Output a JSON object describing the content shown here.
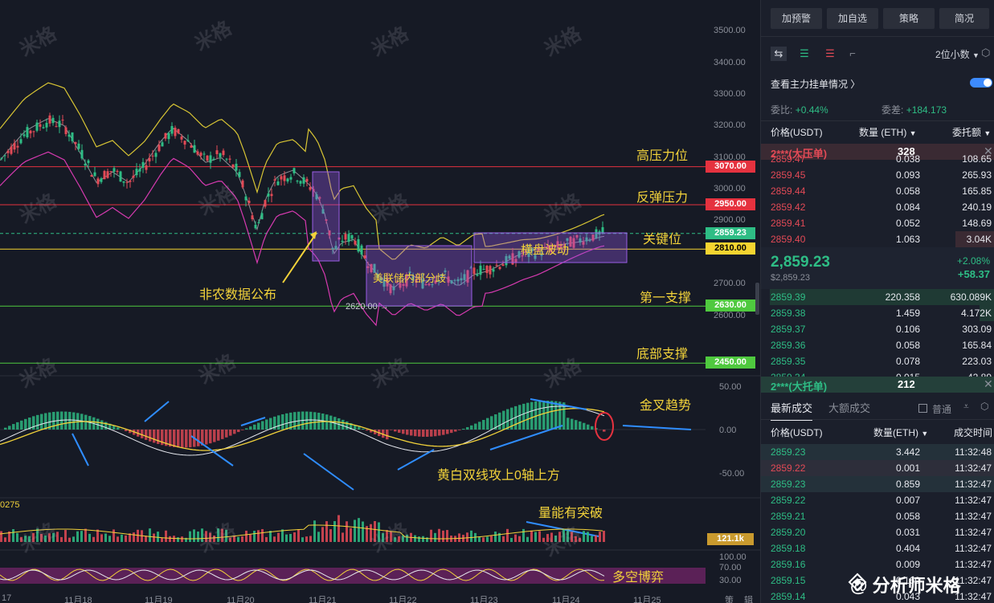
{
  "chart": {
    "y_axis_labels": [
      "3500.00",
      "3400.00",
      "3300.00",
      "3200.00",
      "3100.00",
      "3000.00",
      "2900.00",
      "2800.00",
      "2700.00",
      "2600.00"
    ],
    "x_axis_labels": [
      "17",
      "11月18",
      "11月19",
      "11月20",
      "11月21",
      "11月22",
      "11月23",
      "11月24",
      "11月25",
      "策",
      "辑"
    ],
    "levels": [
      {
        "price": "3070.00",
        "label": "高压力位",
        "color": "#e5323f",
        "tag_text_color": "#ffffff"
      },
      {
        "price": "2950.00",
        "label": "反弹压力",
        "color": "#e5323f",
        "tag_text_color": "#ffffff"
      },
      {
        "price": "2859.23",
        "label": "关键位",
        "color": "#2ebd85",
        "tag_text_color": "#ffffff"
      },
      {
        "price": "2810.00",
        "label": "",
        "color": "#f5d430",
        "tag_text_color": "#000000"
      },
      {
        "price": "2630.00",
        "label": "第一支撑",
        "color": "#4fc93f",
        "tag_text_color": "#ffffff"
      },
      {
        "price": "2450.00",
        "label": "底部支撑",
        "color": "#4fc93f",
        "tag_text_color": "#ffffff"
      }
    ],
    "low_marker": "2620.00 →",
    "annotations": {
      "nfp": "非农数据公布",
      "fed": "美联储内部分歧",
      "sideways": "横盘波动",
      "golden_cross": "金叉趋势",
      "macd_above_zero": "黄白双线攻上0轴上方",
      "volume_break": "量能有突破",
      "bull_bear": "多空博弈"
    },
    "macd_labels": [
      "50.00",
      "0.00",
      "-50.00"
    ],
    "volume_label": "121.1k",
    "volume_left_label": "0275",
    "osc_labels": [
      "100.00",
      "70.00",
      "30.00"
    ],
    "watermark": "米格",
    "brand": "分析师米格"
  },
  "panel": {
    "buttons": [
      "加预警",
      "加自选",
      "策略",
      "简况"
    ],
    "precision": "2位小数",
    "main_orders_label": "查看主力挂单情况",
    "ratio_label": "委比:",
    "ratio_value": "+0.44%",
    "diff_label": "委差:",
    "diff_value": "+184.173",
    "book_headers": [
      "价格(USDT)",
      "数量 (ETH)",
      "委托额"
    ],
    "big_ask": {
      "label": "2***(大压单)",
      "value": "328"
    },
    "asks": [
      {
        "price": "2859.47",
        "qty": "0.038",
        "amt": "108.65"
      },
      {
        "price": "2859.45",
        "qty": "0.093",
        "amt": "265.93"
      },
      {
        "price": "2859.44",
        "qty": "0.058",
        "amt": "165.85"
      },
      {
        "price": "2859.42",
        "qty": "0.084",
        "amt": "240.19"
      },
      {
        "price": "2859.41",
        "qty": "0.052",
        "amt": "148.69"
      },
      {
        "price": "2859.40",
        "qty": "1.063",
        "amt": "3.04K"
      }
    ],
    "last_price": "2,859.23",
    "last_price_sub": "$2,859.23",
    "change_pct": "+2.08%",
    "change_abs": "+58.37",
    "bids": [
      {
        "price": "2859.39",
        "qty": "220.358",
        "amt": "630.089K"
      },
      {
        "price": "2859.38",
        "qty": "1.459",
        "amt": "4.172K"
      },
      {
        "price": "2859.37",
        "qty": "0.106",
        "amt": "303.09"
      },
      {
        "price": "2859.36",
        "qty": "0.058",
        "amt": "165.84"
      },
      {
        "price": "2859.35",
        "qty": "0.078",
        "amt": "223.03"
      },
      {
        "price": "2859.34",
        "qty": "0.015",
        "amt": "42.89"
      }
    ],
    "big_bid": {
      "label": "2***(大托单)",
      "value": "212"
    },
    "trades_tabs": [
      "最新成交",
      "大额成交"
    ],
    "normal_label": "普通",
    "trade_headers": [
      "价格(USDT)",
      "数量(ETH)",
      "成交时间"
    ],
    "trades": [
      {
        "price": "2859.23",
        "qty": "3.442",
        "time": "11:32:48",
        "side": "buy"
      },
      {
        "price": "2859.22",
        "qty": "0.001",
        "time": "11:32:47",
        "side": "sell"
      },
      {
        "price": "2859.23",
        "qty": "0.859",
        "time": "11:32:47",
        "side": "buy"
      },
      {
        "price": "2859.22",
        "qty": "0.007",
        "time": "11:32:47",
        "side": "buy"
      },
      {
        "price": "2859.21",
        "qty": "0.058",
        "time": "11:32:47",
        "side": "buy"
      },
      {
        "price": "2859.20",
        "qty": "0.031",
        "time": "11:32:47",
        "side": "buy"
      },
      {
        "price": "2859.18",
        "qty": "0.404",
        "time": "11:32:47",
        "side": "buy"
      },
      {
        "price": "2859.16",
        "qty": "0.009",
        "time": "11:32:47",
        "side": "buy"
      },
      {
        "price": "2859.15",
        "qty": "0.160",
        "time": "11:32:47",
        "side": "buy"
      },
      {
        "price": "2859.14",
        "qty": "0.043",
        "time": "11:32:47",
        "side": "buy"
      }
    ]
  }
}
